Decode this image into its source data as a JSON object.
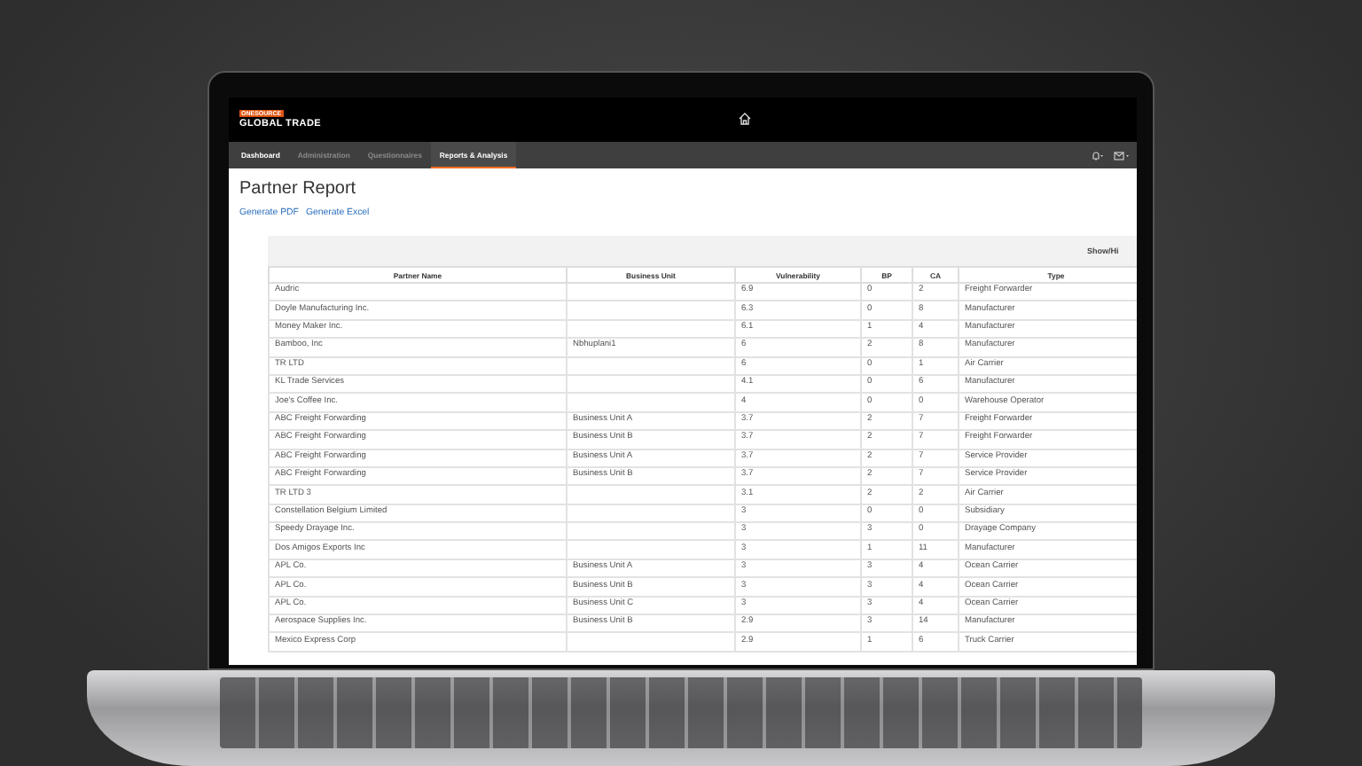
{
  "header": {
    "logo_top": "ONESOURCE",
    "logo_bottom": "GLOBAL TRADE"
  },
  "nav": {
    "tabs": [
      {
        "label": "Dashboard",
        "selected": false,
        "kind": "bright"
      },
      {
        "label": "Administration",
        "selected": false,
        "kind": "dim"
      },
      {
        "label": "Questionnaires",
        "selected": false,
        "kind": "dim"
      },
      {
        "label": "Reports & Analysis",
        "selected": true,
        "kind": "bright"
      }
    ]
  },
  "page": {
    "title": "Partner Report",
    "links": [
      "Generate PDF",
      "Generate Excel"
    ]
  },
  "table": {
    "toolbar_label": "Show/Hi",
    "columns": [
      "Partner Name",
      "Business Unit",
      "Vulnerability",
      "BP",
      "CA",
      "Type"
    ],
    "rows": [
      {
        "partner_name": "Audric",
        "vulnerability": "6.9",
        "bp": "0",
        "ca": "2",
        "type": "Freight Forwarder"
      },
      {
        "partner_name": "Doyle Manufacturing Inc.",
        "vulnerability": "6.3",
        "bp": "0",
        "ca": "8",
        "type": "Manufacturer"
      },
      {
        "partner_name": "Money Maker Inc.",
        "vulnerability": "6.1",
        "bp": "1",
        "ca": "4",
        "type": "Manufacturer"
      },
      {
        "partner_name": "Bamboo, Inc",
        "business_unit": "Nbhuplani1",
        "vulnerability": "6",
        "bp": "2",
        "ca": "8",
        "type": "Manufacturer"
      },
      {
        "partner_name": "TR LTD",
        "vulnerability": "6",
        "bp": "0",
        "ca": "1",
        "type": "Air Carrier"
      },
      {
        "partner_name": "KL Trade Services",
        "vulnerability": "4.1",
        "bp": "0",
        "ca": "6",
        "type": "Manufacturer"
      },
      {
        "partner_name": "Joe's Coffee Inc.",
        "vulnerability": "4",
        "bp": "0",
        "ca": "0",
        "type": "Warehouse Operator"
      },
      {
        "partner_name": "ABC Freight Forwarding",
        "business_unit": "Business Unit A",
        "vulnerability": "3.7",
        "bp": "2",
        "ca": "7",
        "type": "Freight Forwarder"
      },
      {
        "partner_name": "ABC Freight Forwarding",
        "business_unit": "Business Unit B",
        "vulnerability": "3.7",
        "bp": "2",
        "ca": "7",
        "type": "Freight Forwarder"
      },
      {
        "partner_name": "ABC Freight Forwarding",
        "business_unit": "Business Unit A",
        "vulnerability": "3.7",
        "bp": "2",
        "ca": "7",
        "type": "Service Provider"
      },
      {
        "partner_name": "ABC Freight Forwarding",
        "business_unit": "Business Unit B",
        "vulnerability": "3.7",
        "bp": "2",
        "ca": "7",
        "type": "Service Provider"
      },
      {
        "partner_name": "TR LTD 3",
        "vulnerability": "3.1",
        "bp": "2",
        "ca": "2",
        "type": "Air Carrier"
      },
      {
        "partner_name": "Constellation Belgium Limited",
        "vulnerability": "3",
        "bp": "0",
        "ca": "0",
        "type": "Subsidiary"
      },
      {
        "partner_name": "Speedy Drayage Inc.",
        "vulnerability": "3",
        "bp": "3",
        "ca": "0",
        "type": "Drayage Company"
      },
      {
        "partner_name": "Dos Amigos Exports Inc",
        "vulnerability": "3",
        "bp": "1",
        "ca": "11",
        "type": "Manufacturer"
      },
      {
        "partner_name": "APL Co.",
        "business_unit": "Business Unit A",
        "vulnerability": "3",
        "bp": "3",
        "ca": "4",
        "type": "Ocean Carrier"
      },
      {
        "partner_name": "APL Co.",
        "business_unit": "Business Unit B",
        "vulnerability": "3",
        "bp": "3",
        "ca": "4",
        "type": "Ocean Carrier"
      },
      {
        "partner_name": "APL Co.",
        "business_unit": "Business Unit C",
        "vulnerability": "3",
        "bp": "3",
        "ca": "4",
        "type": "Ocean Carrier"
      },
      {
        "partner_name": "Aerospace Supplies Inc.",
        "business_unit": "Business Unit B",
        "vulnerability": "2.9",
        "bp": "3",
        "ca": "14",
        "type": "Manufacturer"
      },
      {
        "partner_name": "Mexico Express Corp",
        "vulnerability": "2.9",
        "bp": "1",
        "ca": "6",
        "type": "Truck Carrier"
      }
    ]
  }
}
